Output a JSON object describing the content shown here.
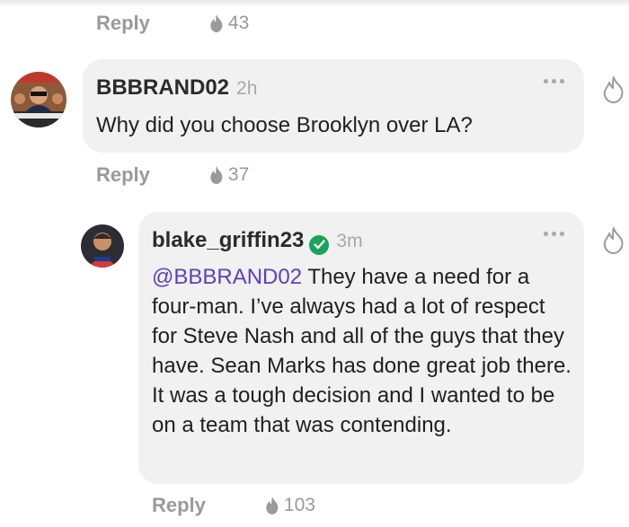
{
  "top_reply": {
    "reply_label": "Reply",
    "fire_count": "43"
  },
  "comment1": {
    "username": "BBBRAND02",
    "timestamp": "2h",
    "text": "Why did you choose Brooklyn over LA?",
    "reply_label": "Reply",
    "fire_count": "37"
  },
  "comment2": {
    "username": "blake_griffin23",
    "verified": true,
    "timestamp": "3m",
    "mention": "@BBBRAND02",
    "text": " They have a need for a four-man. I’ve always had a lot of respect for Steve Nash and all of the guys that they have. Sean Marks has done great job there. It was a tough decision and I wanted to be on a team that was contending.",
    "reply_label": "Reply",
    "fire_count": "103"
  },
  "colors": {
    "mention": "#5b3fc4",
    "verified": "#1aa35a",
    "bubble": "#f1f1f1",
    "muted": "#9a9a9a"
  },
  "icons": [
    "fire-icon",
    "flame-outline-icon",
    "more-dots-icon",
    "verified-check-icon"
  ]
}
